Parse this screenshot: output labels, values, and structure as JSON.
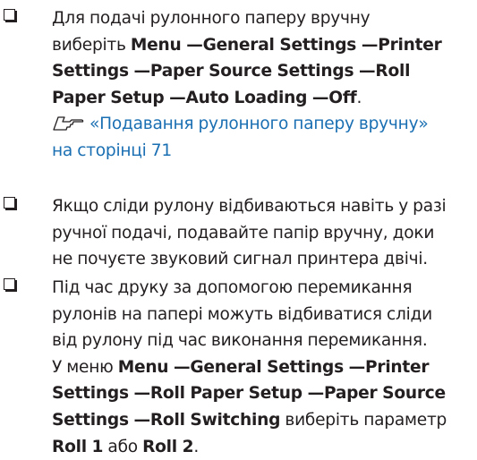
{
  "colors": {
    "text": "#231f20",
    "link": "#1a6fb3",
    "background": "#ffffff"
  },
  "items": [
    {
      "checkbox_icon": "checkbox-icon",
      "lines": {
        "l1": "Для подачі рулонного паперу вручну",
        "l2": "виберіть",
        "l2_b1": "Menu",
        "l2_sep1": " —",
        "l2_b2": "General Settings",
        "l2_sep2": " —",
        "l2_b3": "Printer",
        "l3_b1": "Settings",
        "l3_sep1": " —",
        "l3_b2": "Paper Source Settings",
        "l3_sep2": " —",
        "l3_b3": "Roll",
        "l4_b1": "Paper Setup",
        "l4_sep1": " —",
        "l4_b2": "Auto Loading",
        "l4_sep2": " —",
        "l4_b3": "Off",
        "l4_end": "."
      },
      "reference": {
        "icon": "pointing-hand-icon",
        "line1": "«Подавання рулонного паперу вручну»",
        "line2": "на сторінці 71"
      }
    },
    {
      "checkbox_icon": "checkbox-icon",
      "lines": {
        "l1": "Якщо сліди рулону відбиваються навіть у разі",
        "l2": "ручної подачі, подавайте папір вручну, доки",
        "l3": "не почуєте звуковий сигнал принтера двічі."
      }
    },
    {
      "checkbox_icon": "checkbox-icon",
      "lines": {
        "l1": "Під час друку за допомогою перемикання",
        "l2": "рулонів на папері можуть відбиватися сліди",
        "l3": "від рулону під час виконання перемикання.",
        "l4_pre": "У меню",
        "l4_b1": "Menu",
        "l4_sep1": " —",
        "l4_b2": "General Settings",
        "l4_sep2": " —",
        "l4_b3": "Printer",
        "l5_b1": "Settings",
        "l5_sep1": " —",
        "l5_b2": "Roll Paper Setup",
        "l5_sep2": " —",
        "l5_b3": "Paper Source",
        "l6_b1": "Settings",
        "l6_sep1": " —",
        "l6_b2": "Roll Switching",
        "l6_post": "виберіть параметр",
        "l7_b1": "Roll 1",
        "l7_mid": "або",
        "l7_b2": "Roll 2",
        "l7_end": "."
      }
    }
  ]
}
